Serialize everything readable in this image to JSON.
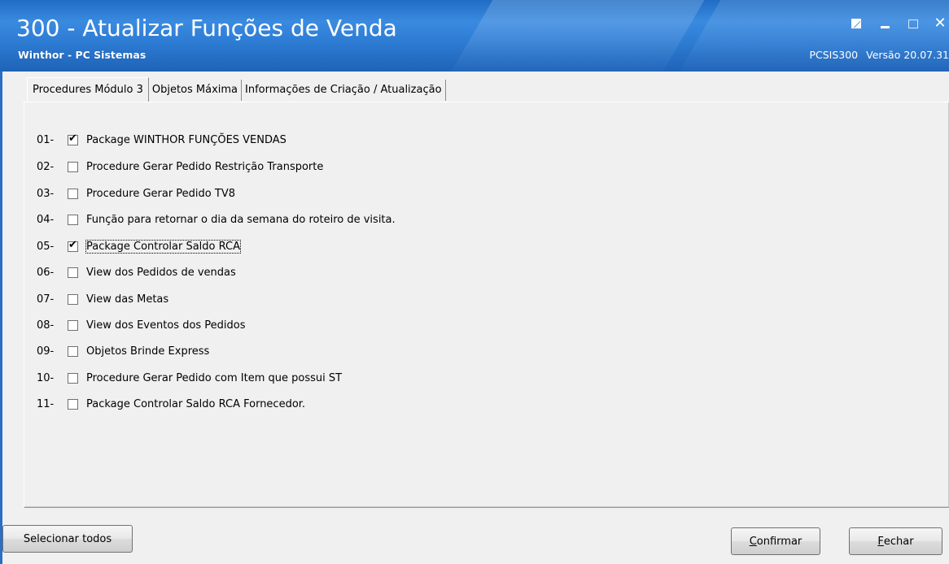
{
  "window": {
    "title": "300 - Atualizar Funções de Venda",
    "subtitle": "Winthor - PC Sistemas",
    "routine_code": "PCSIS300",
    "version": "Versão 20.07.31"
  },
  "tabs": [
    {
      "label": "Procedures Módulo 3",
      "active": true
    },
    {
      "label": "Objetos Máxima",
      "active": false
    },
    {
      "label": "Informações de Criação / Atualização",
      "active": false
    }
  ],
  "items": [
    {
      "num": "01-",
      "label": "Package WINTHOR FUNÇÕES VENDAS",
      "checked": true
    },
    {
      "num": "02-",
      "label": "Procedure Gerar Pedido Restrição Transporte",
      "checked": false
    },
    {
      "num": "03-",
      "label": "Procedure Gerar Pedido TV8",
      "checked": false
    },
    {
      "num": "04-",
      "label": "Função para retornar o dia da semana do roteiro de visita.",
      "checked": false
    },
    {
      "num": "05-",
      "label": "Package Controlar Saldo RCA",
      "checked": true
    },
    {
      "num": "06-",
      "label": "View dos Pedidos de vendas",
      "checked": false
    },
    {
      "num": "07-",
      "label": "View das Metas",
      "checked": false
    },
    {
      "num": "08-",
      "label": "View dos Eventos dos Pedidos",
      "checked": false
    },
    {
      "num": "09-",
      "label": "Objetos Brinde Express",
      "checked": false
    },
    {
      "num": "10-",
      "label": "Procedure Gerar Pedido com Item que possui ST",
      "checked": false
    },
    {
      "num": "11-",
      "label": "Package Controlar Saldo RCA Fornecedor.",
      "checked": false
    }
  ],
  "buttons": {
    "select_all": "Selecionar todos",
    "confirm_first": "C",
    "confirm_rest": "onfirmar",
    "close_first": "F",
    "close_rest": "echar"
  },
  "colors": {
    "titlebar": "#2f7ed6",
    "background": "#f0f0f0"
  }
}
